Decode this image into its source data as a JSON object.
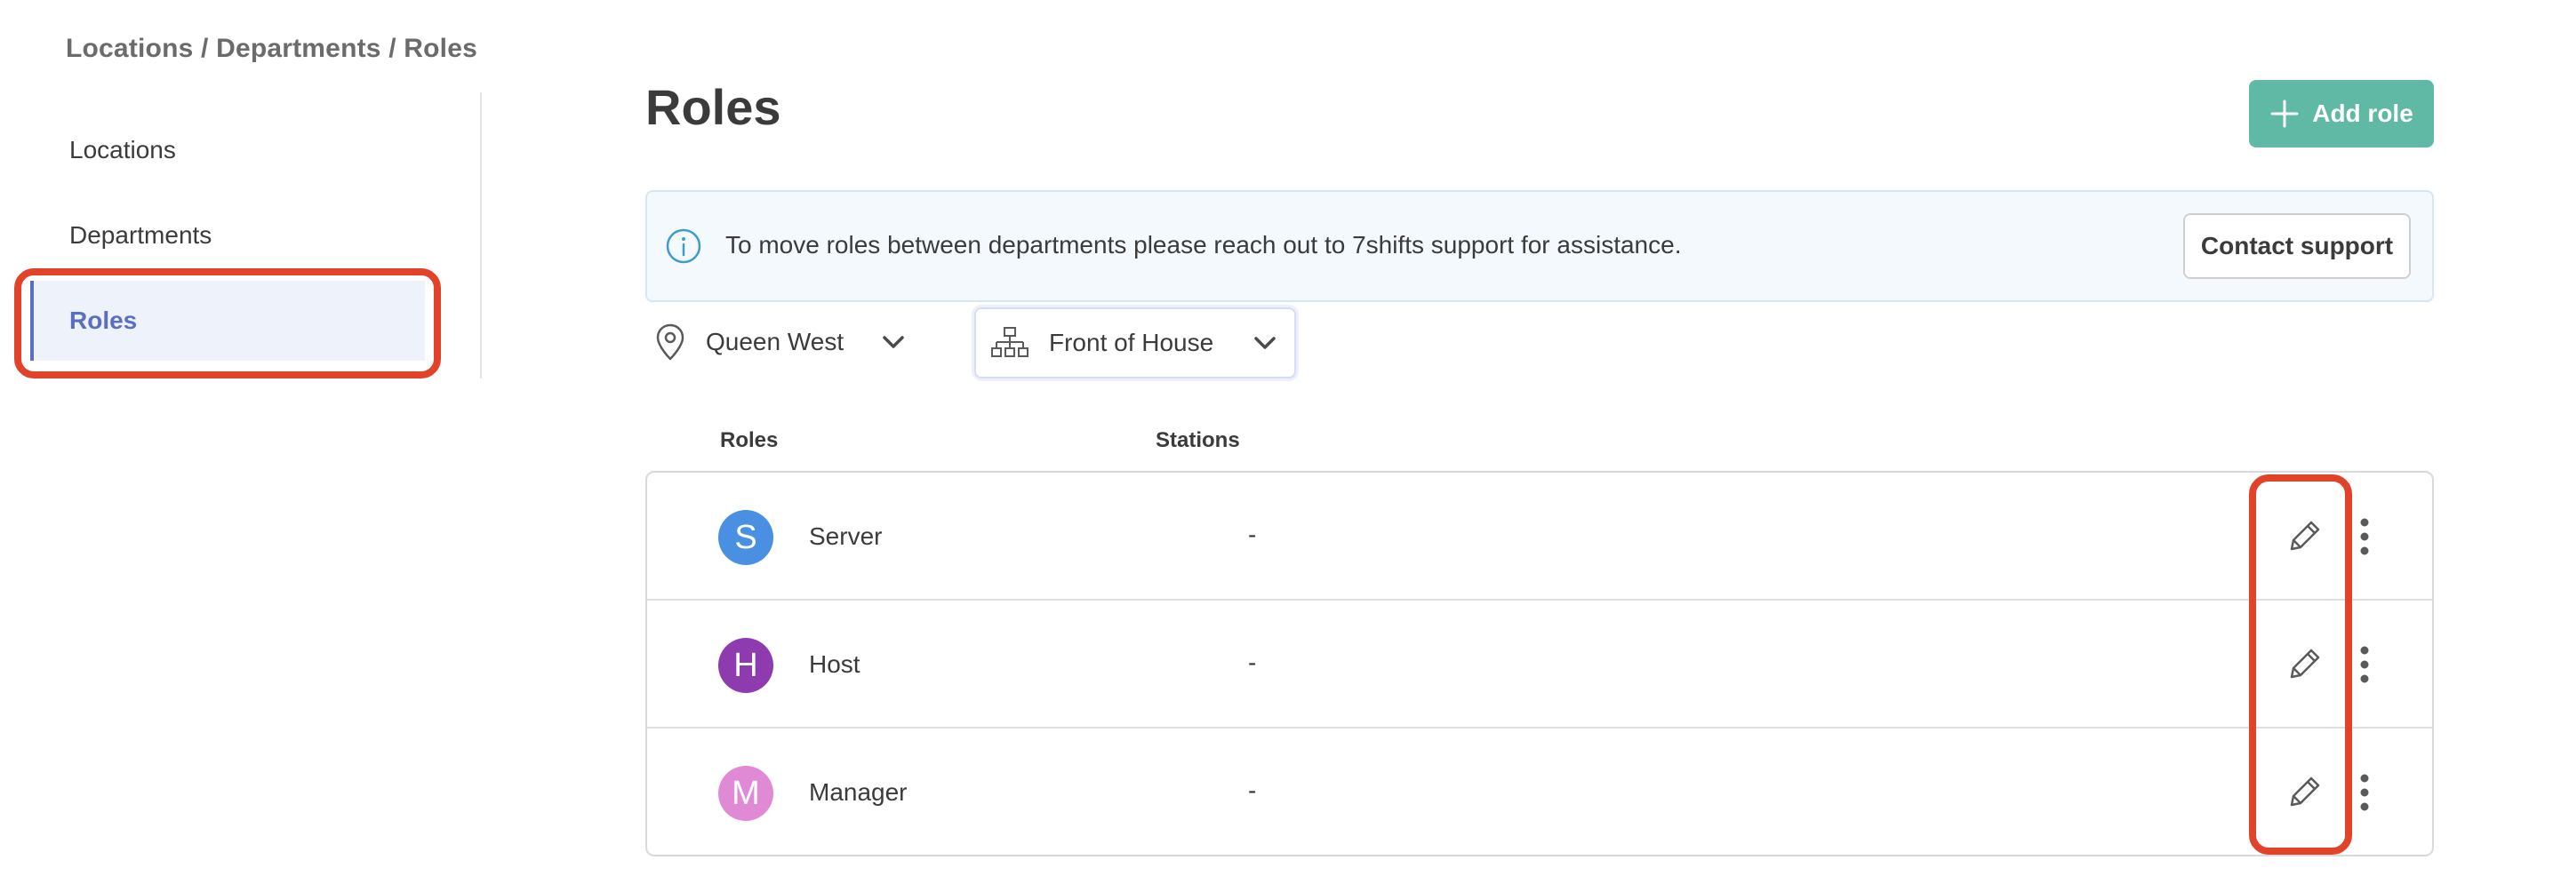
{
  "breadcrumb": "Locations / Departments / Roles",
  "sidebar": {
    "items": [
      {
        "label": "Locations"
      },
      {
        "label": "Departments"
      },
      {
        "label": "Roles"
      }
    ]
  },
  "header": {
    "title": "Roles",
    "add_button_icon": "plus-icon",
    "add_button_label": "Add role"
  },
  "banner": {
    "icon": "info-icon",
    "text": "To move roles between departments please reach out to 7shifts support for assistance.",
    "contact_button_label": "Contact support"
  },
  "filters": {
    "location": {
      "icon": "map-pin-icon",
      "value": "Queen West"
    },
    "department": {
      "icon": "org-chart-icon",
      "value": "Front of House"
    }
  },
  "table": {
    "columns": [
      "Roles",
      "Stations"
    ],
    "rows": [
      {
        "initial": "S",
        "name": "Server",
        "stations": "-",
        "color": "#4a90e2"
      },
      {
        "initial": "H",
        "name": "Host",
        "stations": "-",
        "color": "#8e3bb0"
      },
      {
        "initial": "M",
        "name": "Manager",
        "stations": "-",
        "color": "#e08ad6"
      }
    ]
  },
  "colors": {
    "accent": "#5fb9a5",
    "active_nav": "#5a6fbf",
    "highlight": "#e0432a"
  }
}
